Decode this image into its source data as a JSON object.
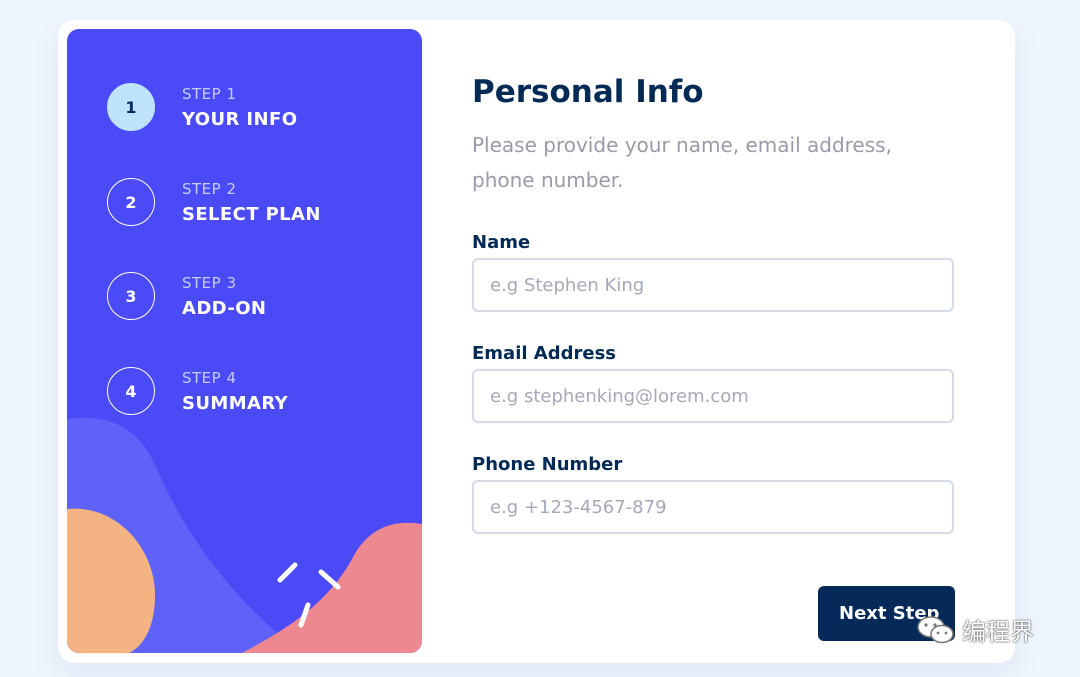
{
  "sidebar": {
    "steps": [
      {
        "number": "1",
        "label": "STEP 1",
        "title": "YOUR INFO",
        "active": true
      },
      {
        "number": "2",
        "label": "STEP 2",
        "title": "SELECT PLAN",
        "active": false
      },
      {
        "number": "3",
        "label": "STEP 3",
        "title": "ADD-ON",
        "active": false
      },
      {
        "number": "4",
        "label": "STEP 4",
        "title": "SUMMARY",
        "active": false
      }
    ]
  },
  "main": {
    "title": "Personal Info",
    "subtitle": "Please provide your name, email address, phone number.",
    "fields": {
      "name": {
        "label": "Name",
        "placeholder": "e.g Stephen King",
        "value": ""
      },
      "email": {
        "label": "Email Address",
        "placeholder": "e.g stephenking@lorem.com",
        "value": ""
      },
      "phone": {
        "label": "Phone Number",
        "placeholder": "e.g +123-4567-879",
        "value": ""
      }
    },
    "next_label": "Next Step"
  },
  "watermark": {
    "text": "编程界",
    "icon": "wechat-icon"
  },
  "colors": {
    "sidebar_bg": "#4a4af7",
    "active_step": "#bfe2fd",
    "primary_dark": "#032a55",
    "blob_orange": "#f4b383",
    "blob_pink": "#ed8891",
    "blob_lavender": "#5f62f8"
  }
}
